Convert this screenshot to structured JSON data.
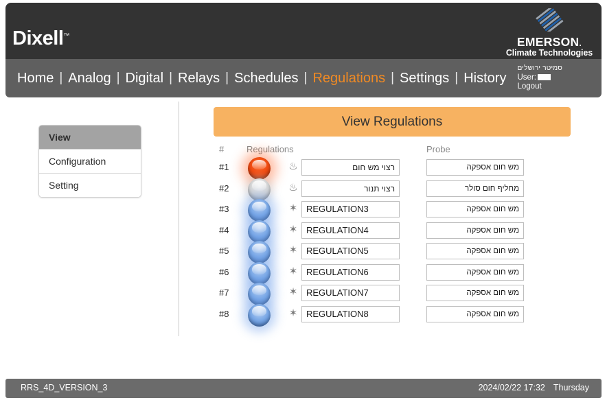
{
  "header": {
    "brand": "Dixell",
    "brand_tm": "™",
    "partner_name": "EMERSON",
    "partner_dot": ".",
    "partner_sub": "Climate Technologies"
  },
  "nav": {
    "items": [
      {
        "label": "Home",
        "active": false
      },
      {
        "label": "Analog",
        "active": false
      },
      {
        "label": "Digital",
        "active": false
      },
      {
        "label": "Relays",
        "active": false
      },
      {
        "label": "Schedules",
        "active": false
      },
      {
        "label": "Regulations",
        "active": true
      },
      {
        "label": "Settings",
        "active": false
      },
      {
        "label": "History",
        "active": false
      }
    ],
    "separator": "|",
    "site_name": "סמיטר ירושלים",
    "user_label": "User:",
    "user_value": "",
    "logout_label": "Logout"
  },
  "sidebar": {
    "header": "View",
    "items": [
      {
        "label": "Configuration"
      },
      {
        "label": "Setting"
      }
    ]
  },
  "main": {
    "banner_label": "View Regulations",
    "columns": {
      "number": "#",
      "regulations": "Regulations",
      "probe": "Probe"
    },
    "rows": [
      {
        "num": "#1",
        "lamp": "red",
        "icon": "flame-icon",
        "icon_glyph": "♨",
        "regulation": "רצוי מש חום",
        "rtl": true,
        "probe": "מש חום אספקה"
      },
      {
        "num": "#2",
        "lamp": "gray",
        "icon": "flame-icon",
        "icon_glyph": "♨",
        "regulation": "רצוי תנור",
        "rtl": true,
        "probe": "מחליף חום סולר"
      },
      {
        "num": "#3",
        "lamp": "blue",
        "icon": "snowflake-icon",
        "icon_glyph": "✶",
        "regulation": "REGULATION3",
        "rtl": false,
        "probe": "מש חום אספקה"
      },
      {
        "num": "#4",
        "lamp": "blue",
        "icon": "snowflake-icon",
        "icon_glyph": "✶",
        "regulation": "REGULATION4",
        "rtl": false,
        "probe": "מש חום אספקה"
      },
      {
        "num": "#5",
        "lamp": "blue",
        "icon": "snowflake-icon",
        "icon_glyph": "✶",
        "regulation": "REGULATION5",
        "rtl": false,
        "probe": "מש חום אספקה"
      },
      {
        "num": "#6",
        "lamp": "blue",
        "icon": "snowflake-icon",
        "icon_glyph": "✶",
        "regulation": "REGULATION6",
        "rtl": false,
        "probe": "מש חום אספקה"
      },
      {
        "num": "#7",
        "lamp": "blue",
        "icon": "snowflake-icon",
        "icon_glyph": "✶",
        "regulation": "REGULATION7",
        "rtl": false,
        "probe": "מש חום אספקה"
      },
      {
        "num": "#8",
        "lamp": "blue",
        "icon": "snowflake-icon",
        "icon_glyph": "✶",
        "regulation": "REGULATION8",
        "rtl": false,
        "probe": "מש חום אספקה"
      }
    ]
  },
  "footer": {
    "version": "RRS_4D_VERSION_3",
    "datetime": "2024/02/22 17:32",
    "weekday": "Thursday"
  },
  "colors": {
    "header_bg": "#333333",
    "nav_bg": "#5f5f5f",
    "accent_orange": "#f08a24",
    "banner_bg": "#f7b261",
    "footer_bg": "#6b6b6b",
    "sidebar_head_bg": "#a3a3a3",
    "lamp_red": "#f04a10",
    "lamp_gray": "#d4d4d4",
    "lamp_blue": "#7aa8e6"
  }
}
